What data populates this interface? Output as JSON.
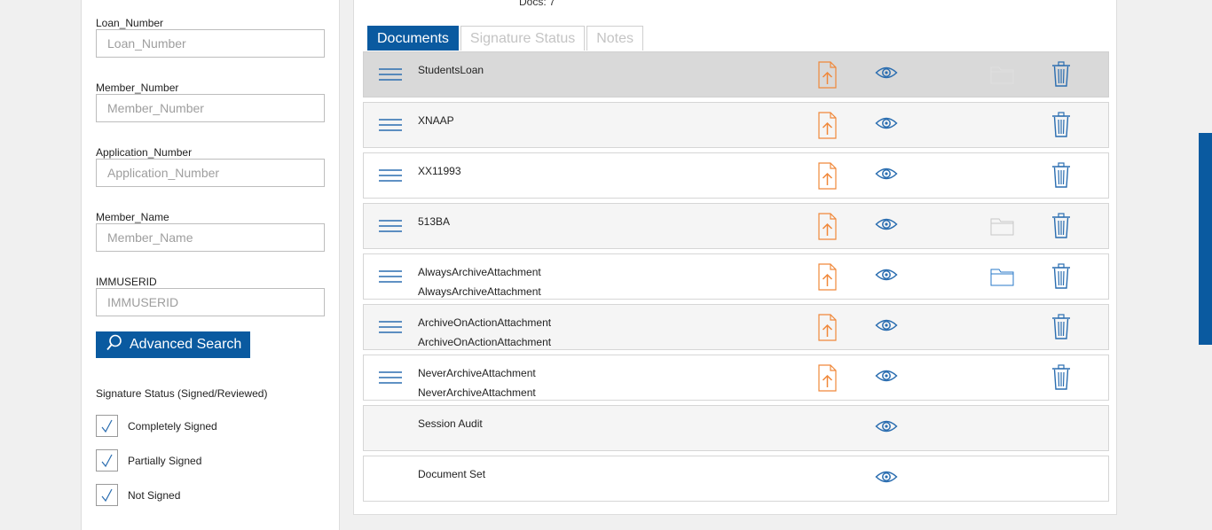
{
  "filters": {
    "fields": [
      {
        "label": "Loan_Number",
        "placeholder": "Loan_Number",
        "value": ""
      },
      {
        "label": "Member_Number",
        "placeholder": "Member_Number",
        "value": ""
      },
      {
        "label": "Application_Number",
        "placeholder": "Application_Number",
        "value": ""
      },
      {
        "label": "Member_Name",
        "placeholder": "Member_Name",
        "value": ""
      },
      {
        "label": "IMMUSERID",
        "placeholder": "IMMUSERID",
        "value": ""
      }
    ],
    "search_button": {
      "label": "Advanced Search",
      "icon": "search-icon"
    },
    "signature_heading": "Signature Status (Signed/Reviewed)",
    "signature_options": [
      {
        "label": "Completely Signed",
        "checked": true
      },
      {
        "label": "Partially Signed",
        "checked": true
      },
      {
        "label": "Not Signed",
        "checked": true
      }
    ]
  },
  "main": {
    "docs_count": "Docs: 7",
    "tabs": [
      {
        "label": "Documents",
        "active": true
      },
      {
        "label": "Signature Status",
        "active": false
      },
      {
        "label": "Notes",
        "active": false
      }
    ],
    "documents": [
      {
        "name": "StudentsLoan",
        "name2": "",
        "menu": true,
        "upload": true,
        "view": true,
        "folder": "faded",
        "delete": true,
        "style": "selected"
      },
      {
        "name": "XNAAP",
        "name2": "",
        "menu": true,
        "upload": true,
        "view": true,
        "folder": "none",
        "delete": true,
        "style": "alt"
      },
      {
        "name": "XX11993",
        "name2": "",
        "menu": true,
        "upload": true,
        "view": true,
        "folder": "none",
        "delete": true,
        "style": "plain"
      },
      {
        "name": "513BA",
        "name2": "",
        "menu": true,
        "upload": true,
        "view": true,
        "folder": "gray",
        "delete": true,
        "style": "alt"
      },
      {
        "name": "AlwaysArchiveAttachment",
        "name2": "AlwaysArchiveAttachment",
        "menu": true,
        "upload": true,
        "view": true,
        "folder": "blue",
        "delete": true,
        "style": "plain"
      },
      {
        "name": "ArchiveOnActionAttachment",
        "name2": "ArchiveOnActionAttachment",
        "menu": true,
        "upload": true,
        "view": true,
        "folder": "none",
        "delete": true,
        "style": "alt"
      },
      {
        "name": "NeverArchiveAttachment",
        "name2": "NeverArchiveAttachment",
        "menu": true,
        "upload": true,
        "view": true,
        "folder": "none",
        "delete": true,
        "style": "plain"
      },
      {
        "name": "Session Audit",
        "name2": "",
        "menu": false,
        "upload": false,
        "view": true,
        "folder": "none",
        "delete": false,
        "style": "alt"
      },
      {
        "name": "Document Set",
        "name2": "",
        "menu": false,
        "upload": false,
        "view": true,
        "folder": "none",
        "delete": false,
        "style": "plain"
      }
    ]
  },
  "colors": {
    "accent": "#0a5aa0",
    "upload_icon": "#f0883a",
    "icon_blue": "#2a6db0",
    "folder_gray": "#c8c8c8",
    "folder_faded": "#e0e0e0",
    "folder_blue": "#2a7ac8"
  }
}
